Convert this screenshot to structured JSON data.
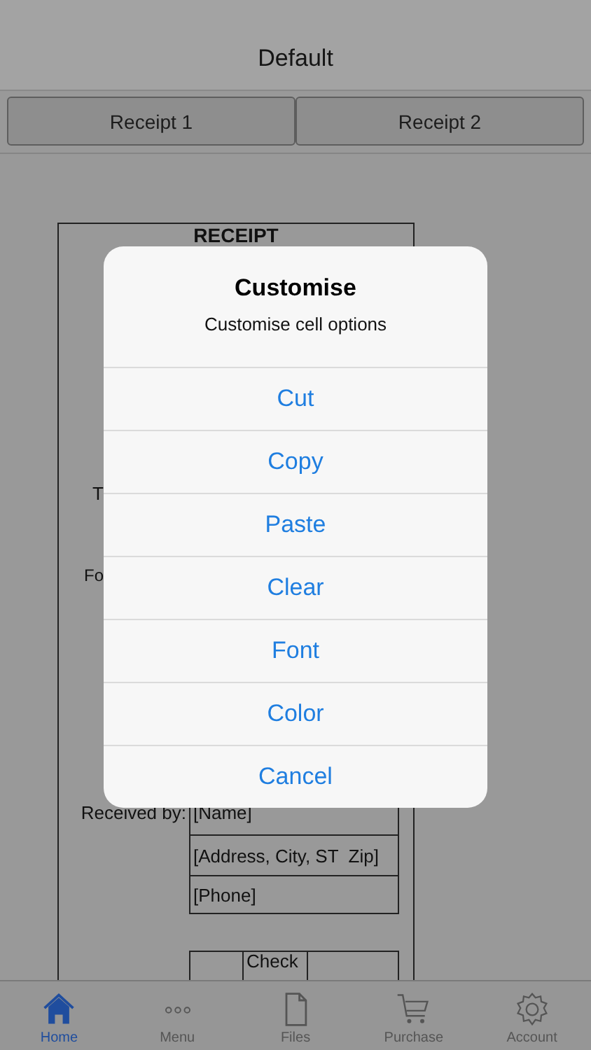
{
  "nav_bar": {
    "title": "Default"
  },
  "segments": [
    {
      "label": "Receipt 1",
      "selected": false
    },
    {
      "label": "Receipt 2",
      "selected": false
    }
  ],
  "receipt": {
    "title": "RECEIPT",
    "fragments": [
      "T",
      "Fo"
    ],
    "received_by_label": "Received by:",
    "received_by_lines": [
      "[Name]",
      "[Address, City, ST  Zip]",
      "[Phone]"
    ],
    "payment_label": "Check"
  },
  "dialog": {
    "title": "Customise",
    "message": "Customise cell options",
    "actions": [
      "Cut",
      "Copy",
      "Paste",
      "Clear",
      "Font",
      "Color",
      "Cancel"
    ]
  },
  "tab_bar": [
    {
      "label": "Home",
      "selected": true
    },
    {
      "label": "Menu",
      "selected": false
    },
    {
      "label": "Files",
      "selected": false
    },
    {
      "label": "Purchase",
      "selected": false
    },
    {
      "label": "Account",
      "selected": false
    }
  ]
}
